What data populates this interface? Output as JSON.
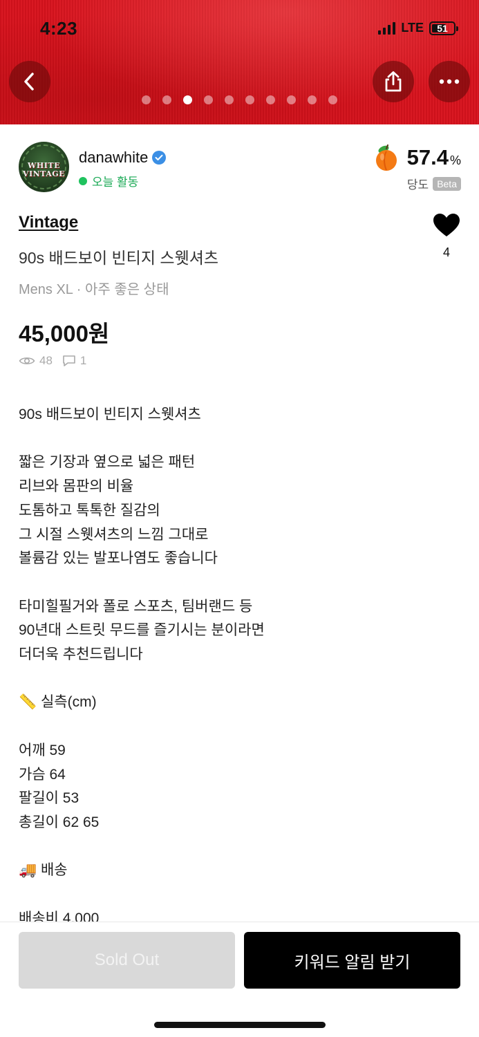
{
  "status_bar": {
    "time": "4:23",
    "network": "LTE",
    "battery": "51"
  },
  "gallery": {
    "page_count": 10,
    "active_index": 2
  },
  "seller": {
    "name": "danawhite",
    "activity": "오늘 활동",
    "avatar_text_line1": "WHITE",
    "avatar_text_line2": "VINTAGE",
    "rating_value": "57.4",
    "rating_unit": "%",
    "rating_label": "당도",
    "rating_badge": "Beta"
  },
  "product": {
    "brand": "Vintage",
    "title": "90s 배드보이 빈티지 스웻셔츠",
    "meta": "Mens XL · 아주 좋은 상태",
    "price": "45,000원",
    "views": "48",
    "comments": "1",
    "likes": "4",
    "description": "90s 배드보이 빈티지 스웻셔츠\n\n짧은 기장과 옆으로 넓은 패턴\n리브와 몸판의 비율\n도톰하고 톡톡한 질감의\n그 시절 스웻셔츠의 느낌 그대로\n볼륨감 있는 발포나염도 좋습니다\n\n타미힐필거와 폴로 스포츠, 팀버랜드 등\n90년대 스트릿 무드를 즐기시는 분이라면\n더더욱 추천드립니다\n\n📏 실측(cm)\n\n어깨 59\n가슴 64\n팔길이 53\n총길이 62 65\n\n🚚 배송\n\n배송비 4,000"
  },
  "actions": {
    "sold_out_label": "Sold Out",
    "keyword_alert_label": "키워드 알림 받기"
  },
  "colors": {
    "hero": "#d8121c",
    "accent_green": "#1fc25e",
    "verified_blue": "#3b8fe5"
  }
}
